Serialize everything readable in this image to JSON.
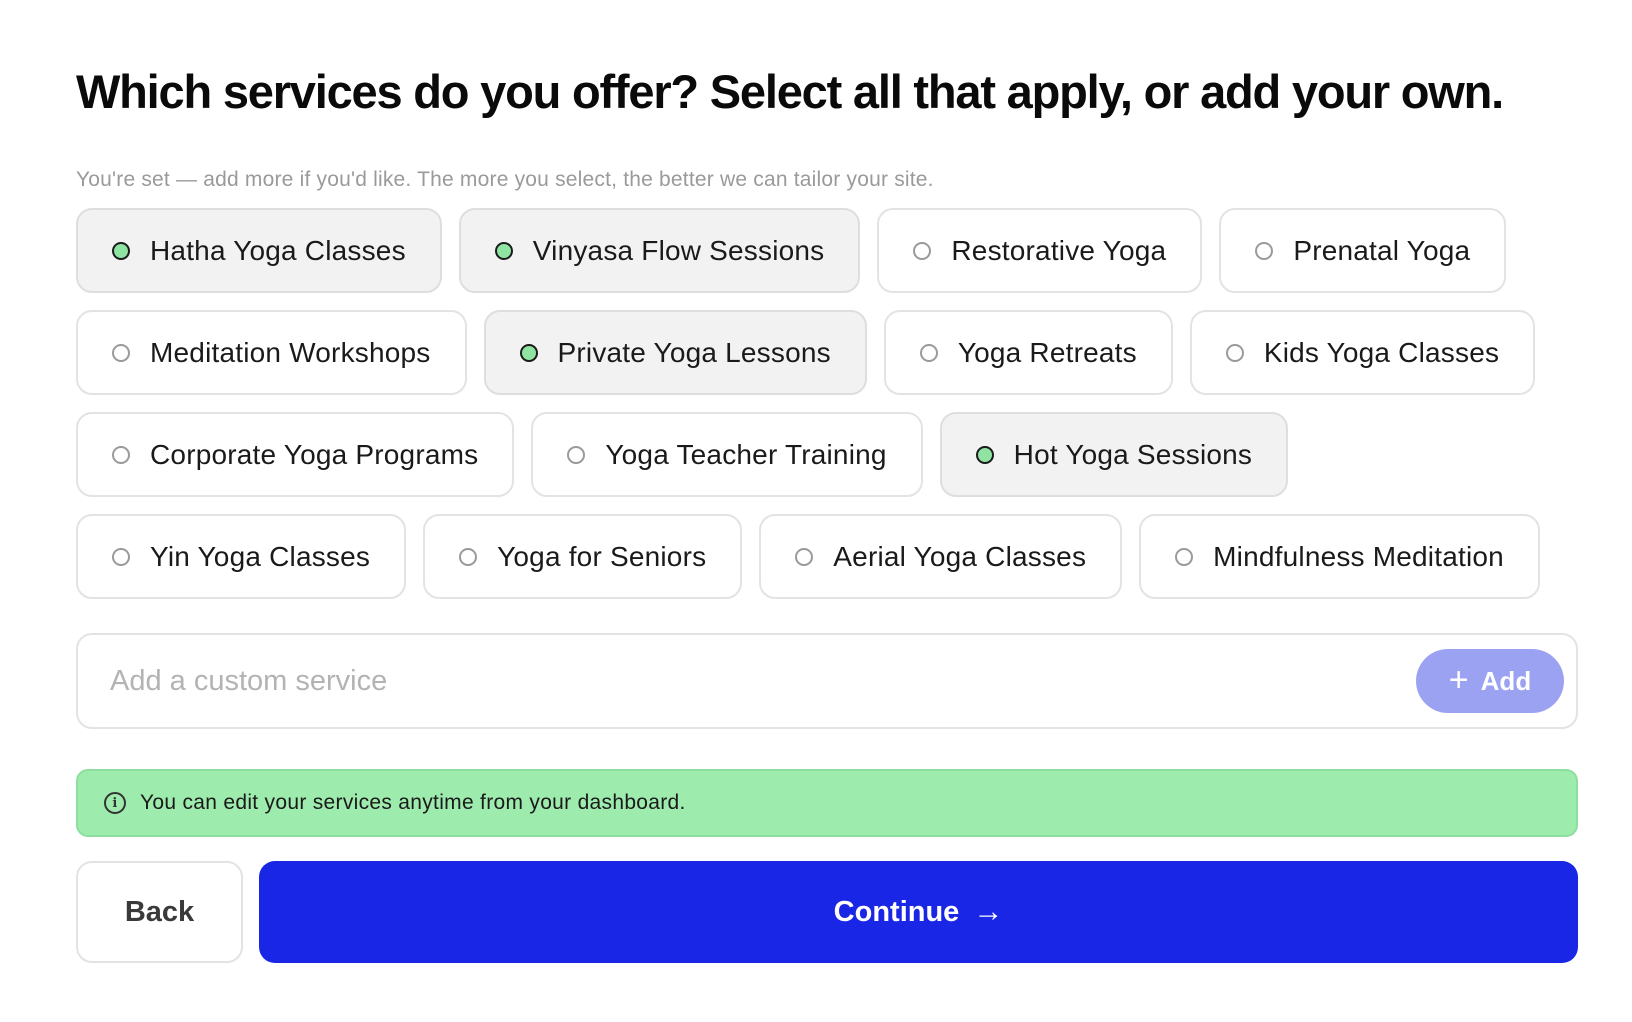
{
  "header": {
    "title": "Which services do you offer? Select all that apply, or add your own.",
    "subtitle": "You're set — add more if you'd like. The more you select, the better we can tailor your site."
  },
  "services": [
    {
      "label": "Hatha Yoga Classes",
      "selected": true
    },
    {
      "label": "Vinyasa Flow Sessions",
      "selected": true
    },
    {
      "label": "Restorative Yoga",
      "selected": false
    },
    {
      "label": "Prenatal Yoga",
      "selected": false
    },
    {
      "label": "Meditation Workshops",
      "selected": false
    },
    {
      "label": "Private Yoga Lessons",
      "selected": true
    },
    {
      "label": "Yoga Retreats",
      "selected": false
    },
    {
      "label": "Kids Yoga Classes",
      "selected": false
    },
    {
      "label": "Corporate Yoga Programs",
      "selected": false
    },
    {
      "label": "Yoga Teacher Training",
      "selected": false
    },
    {
      "label": "Hot Yoga Sessions",
      "selected": true
    },
    {
      "label": "Yin Yoga Classes",
      "selected": false
    },
    {
      "label": "Yoga for Seniors",
      "selected": false
    },
    {
      "label": "Aerial Yoga Classes",
      "selected": false
    },
    {
      "label": "Mindfulness Meditation",
      "selected": false
    }
  ],
  "custom_service": {
    "placeholder": "Add a custom service",
    "value": "",
    "add_label": "Add",
    "add_icon": "plus-icon"
  },
  "info": {
    "icon": "info-icon",
    "text": "You can edit your services anytime from your dashboard."
  },
  "actions": {
    "back_label": "Back",
    "continue_label": "Continue",
    "continue_icon": "arrow-right-icon"
  },
  "colors": {
    "selected_dot": "#8ee4a0",
    "primary": "#1a26e6",
    "add_button": "#9ba2f2",
    "info_bg": "#9eebae"
  }
}
